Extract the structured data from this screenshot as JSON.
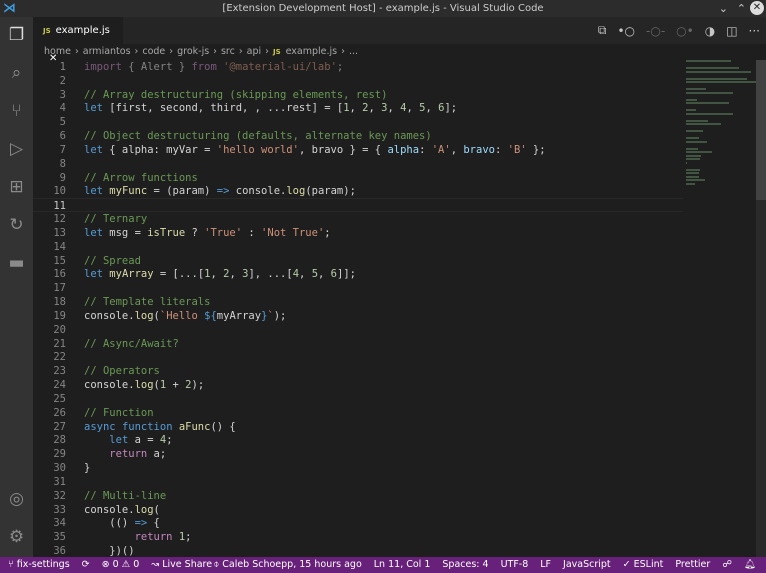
{
  "window": {
    "title": "[Extension Development Host] - example.js - Visual Studio Code"
  },
  "activity_bar": [
    "explorer-icon",
    "search-icon",
    "source-control-icon",
    "run-debug-icon",
    "extensions-icon",
    "live-share-icon",
    "docker-icon",
    "account-icon",
    "gear-icon"
  ],
  "tab": {
    "label": "example.js",
    "icon": "JS"
  },
  "breadcrumb": [
    "home",
    "armiantos",
    "code",
    "grok-js",
    "src",
    "api",
    "example.js",
    "..."
  ],
  "editor": {
    "current_line": 11,
    "lines": [
      [
        [
          "ctrl dim",
          "import"
        ],
        [
          "p dim",
          " { Alert } "
        ],
        [
          "ctrl dim",
          "from"
        ],
        [
          "s dim",
          " '@material-ui/lab'"
        ],
        [
          "p dim",
          ";"
        ]
      ],
      [],
      [
        [
          "c",
          "// Array destructuring (skipping elements, rest)"
        ]
      ],
      [
        [
          "k",
          "let"
        ],
        [
          "p",
          " [first, second, third, , ...rest] = ["
        ],
        [
          "n",
          "1"
        ],
        [
          "p",
          ", "
        ],
        [
          "n",
          "2"
        ],
        [
          "p",
          ", "
        ],
        [
          "n",
          "3"
        ],
        [
          "p",
          ", "
        ],
        [
          "n",
          "4"
        ],
        [
          "p",
          ", "
        ],
        [
          "n",
          "5"
        ],
        [
          "p",
          ", "
        ],
        [
          "n",
          "6"
        ],
        [
          "p",
          "];"
        ]
      ],
      [],
      [
        [
          "c",
          "// Object destructuring (defaults, alternate key names)"
        ]
      ],
      [
        [
          "k",
          "let"
        ],
        [
          "p",
          " { alpha: myVar = "
        ],
        [
          "s",
          "'hello world'"
        ],
        [
          "p",
          ", bravo } = { "
        ],
        [
          "v",
          "alpha"
        ],
        [
          "p",
          ": "
        ],
        [
          "s",
          "'A'"
        ],
        [
          "p",
          ", "
        ],
        [
          "v",
          "bravo"
        ],
        [
          "p",
          ": "
        ],
        [
          "s",
          "'B'"
        ],
        [
          "p",
          " };"
        ]
      ],
      [],
      [
        [
          "c",
          "// Arrow functions"
        ]
      ],
      [
        [
          "k",
          "let"
        ],
        [
          "p",
          " "
        ],
        [
          "f",
          "myFunc"
        ],
        [
          "p",
          " = (param) "
        ],
        [
          "k",
          "=>"
        ],
        [
          "p",
          " console."
        ],
        [
          "f",
          "log"
        ],
        [
          "p",
          "(param);"
        ]
      ],
      [],
      [
        [
          "c",
          "// Ternary"
        ]
      ],
      [
        [
          "k",
          "let"
        ],
        [
          "p",
          " msg = "
        ],
        [
          "f",
          "isTrue"
        ],
        [
          "p",
          " ? "
        ],
        [
          "s",
          "'True'"
        ],
        [
          "p",
          " : "
        ],
        [
          "s",
          "'Not True'"
        ],
        [
          "p",
          ";"
        ]
      ],
      [],
      [
        [
          "c",
          "// Spread"
        ]
      ],
      [
        [
          "k",
          "let"
        ],
        [
          "p",
          " "
        ],
        [
          "f",
          "myArray"
        ],
        [
          "p",
          " = [...["
        ],
        [
          "n",
          "1"
        ],
        [
          "p",
          ", "
        ],
        [
          "n",
          "2"
        ],
        [
          "p",
          ", "
        ],
        [
          "n",
          "3"
        ],
        [
          "p",
          "], ...["
        ],
        [
          "n",
          "4"
        ],
        [
          "p",
          ", "
        ],
        [
          "n",
          "5"
        ],
        [
          "p",
          ", "
        ],
        [
          "n",
          "6"
        ],
        [
          "p",
          "]];"
        ]
      ],
      [],
      [
        [
          "c",
          "// Template literals"
        ]
      ],
      [
        [
          "p",
          "console."
        ],
        [
          "f",
          "log"
        ],
        [
          "p",
          "("
        ],
        [
          "s",
          "`Hello "
        ],
        [
          "k",
          "${"
        ],
        [
          "p",
          "myArray"
        ],
        [
          "k",
          "}"
        ],
        [
          "s",
          "`"
        ],
        [
          "p",
          ");"
        ]
      ],
      [],
      [
        [
          "c",
          "// Async/Await?"
        ]
      ],
      [],
      [
        [
          "c",
          "// Operators"
        ]
      ],
      [
        [
          "p",
          "console."
        ],
        [
          "f",
          "log"
        ],
        [
          "p",
          "("
        ],
        [
          "n",
          "1"
        ],
        [
          "p",
          " + "
        ],
        [
          "n",
          "2"
        ],
        [
          "p",
          ");"
        ]
      ],
      [],
      [
        [
          "c",
          "// Function"
        ]
      ],
      [
        [
          "k",
          "async"
        ],
        [
          "p",
          " "
        ],
        [
          "k",
          "function"
        ],
        [
          "p",
          " "
        ],
        [
          "f",
          "aFunc"
        ],
        [
          "p",
          "() {"
        ]
      ],
      [
        [
          "p",
          "    "
        ],
        [
          "k",
          "let"
        ],
        [
          "p",
          " a = "
        ],
        [
          "n",
          "4"
        ],
        [
          "p",
          ";"
        ]
      ],
      [
        [
          "p",
          "    "
        ],
        [
          "ctrl",
          "return"
        ],
        [
          "p",
          " a;"
        ]
      ],
      [
        [
          "p",
          "}"
        ]
      ],
      [],
      [
        [
          "c",
          "// Multi-line"
        ]
      ],
      [
        [
          "p",
          "console."
        ],
        [
          "f",
          "log"
        ],
        [
          "p",
          "("
        ]
      ],
      [
        [
          "p",
          "    (() "
        ],
        [
          "k",
          "=>"
        ],
        [
          "p",
          " {"
        ]
      ],
      [
        [
          "p",
          "        "
        ],
        [
          "ctrl",
          "return"
        ],
        [
          "p",
          " "
        ],
        [
          "n",
          "1"
        ],
        [
          "p",
          ";"
        ]
      ],
      [
        [
          "p",
          "    })()"
        ]
      ]
    ]
  },
  "status": {
    "branch": "fix-settings",
    "errors": "0",
    "warnings": "0",
    "live_share": "Live Share",
    "blame": "Caleb Schoepp, 15 hours ago",
    "position": "Ln 11, Col 1",
    "spaces": "Spaces: 4",
    "encoding": "UTF-8",
    "eol": "LF",
    "language": "JavaScript",
    "eslint": "ESLint",
    "prettier": "Prettier"
  }
}
